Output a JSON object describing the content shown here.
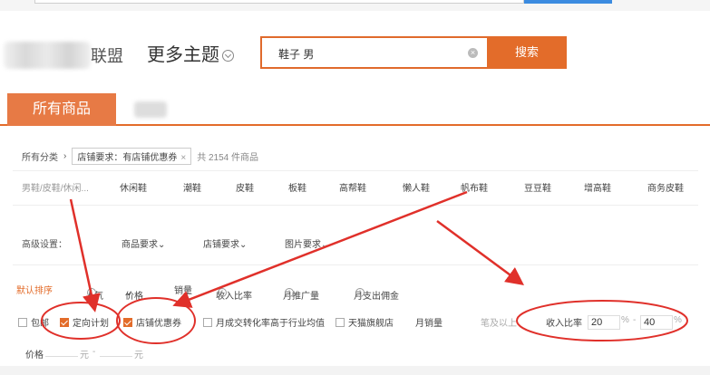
{
  "header": {
    "logo_tail": "联盟",
    "more_theme": "更多主题"
  },
  "search": {
    "value": "鞋子 男",
    "button_label": "搜索"
  },
  "tabs": {
    "active": "所有商品"
  },
  "crumbs": {
    "root": "所有分类",
    "tag": "店铺要求：有店铺优惠券",
    "count": "共 2154 件商品"
  },
  "categories": [
    "男鞋/皮鞋/休闲...",
    "休闲鞋",
    "潮鞋",
    "皮鞋",
    "板鞋",
    "高帮鞋",
    "懒人鞋",
    "帆布鞋",
    "豆豆鞋",
    "增高鞋",
    "商务皮鞋"
  ],
  "advanced": {
    "label": "高级设置：",
    "items": [
      "商品要求",
      "店铺要求",
      "图片要求"
    ]
  },
  "sort": {
    "items": [
      "默认排序",
      "人气",
      "价格",
      "销量",
      "收入比率",
      "月推广量",
      "月支出佣金"
    ]
  },
  "filters": {
    "free_shipping": "包邮",
    "targeted_plan": "定向计划",
    "shop_coupon": "店铺优惠券",
    "conversion": "月成交转化率高于行业均值",
    "tmall": "天猫旗舰店",
    "monthly_sales": "月销量",
    "above": "笔及以上",
    "ratio_label": "收入比率",
    "ratio_min": "20",
    "ratio_max": "40",
    "pct": "%",
    "dash": "-"
  },
  "price": {
    "label": "价格",
    "unit": "元",
    "dash": "-"
  },
  "colors": {
    "accent": "#e36c2a",
    "annotation": "#e0302a"
  }
}
